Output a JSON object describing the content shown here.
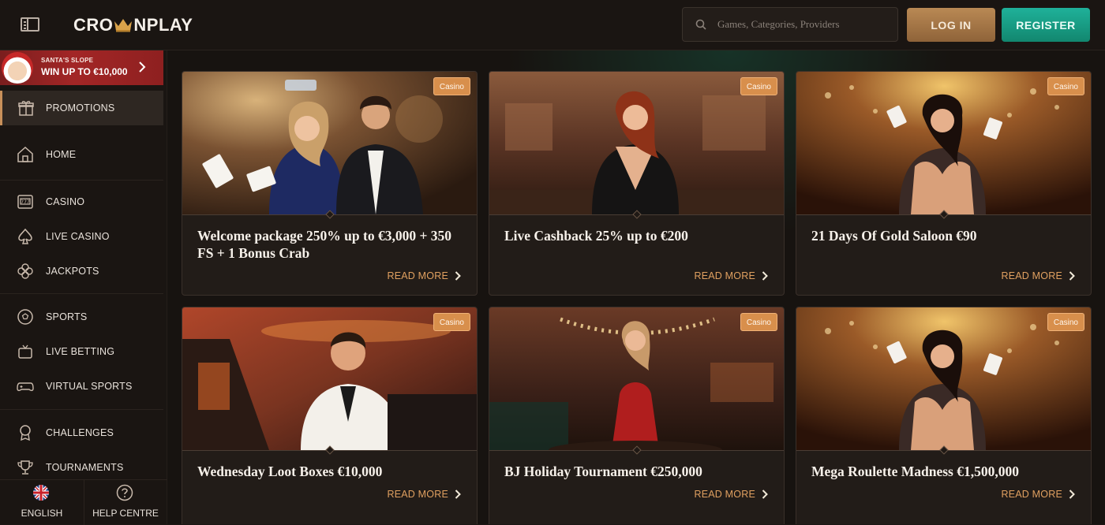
{
  "header": {
    "logo_left": "CRO",
    "logo_right": "NPLAY",
    "search_placeholder": "Games, Categories, Providers",
    "login_label": "LOG IN",
    "register_label": "REGISTER"
  },
  "sidebar": {
    "promo_banner": {
      "small": "SANTA'S SLOPE",
      "big": "WIN UP TO €10,000"
    },
    "active_item": {
      "label": "PROMOTIONS",
      "icon": "gift-icon"
    },
    "items": [
      {
        "label": "HOME",
        "icon": "home-icon"
      },
      {
        "label": "CASINO",
        "icon": "slot-machine-icon"
      },
      {
        "label": "LIVE CASINO",
        "icon": "spade-icon"
      },
      {
        "label": "JACKPOTS",
        "icon": "clover-icon"
      },
      {
        "label": "SPORTS",
        "icon": "soccer-ball-icon"
      },
      {
        "label": "LIVE BETTING",
        "icon": "tv-icon"
      },
      {
        "label": "VIRTUAL SPORTS",
        "icon": "gamepad-icon"
      },
      {
        "label": "CHALLENGES",
        "icon": "medal-icon"
      },
      {
        "label": "TOURNAMENTS",
        "icon": "trophy-icon"
      }
    ],
    "footer": {
      "language_label": "ENGLISH",
      "help_label": "HELP CENTRE"
    }
  },
  "promotions": [
    {
      "badge": "Casino",
      "title": "Welcome package 250% up to €3,000 + 350 FS + 1 Bonus Crab",
      "cta": "READ MORE"
    },
    {
      "badge": "Casino",
      "title": "Live Cashback 25% up to €200",
      "cta": "READ MORE"
    },
    {
      "badge": "Casino",
      "title": "21 Days Of Gold Saloon €90",
      "cta": "READ MORE"
    },
    {
      "badge": "Casino",
      "title": "Wednesday Loot Boxes €10,000",
      "cta": "READ MORE"
    },
    {
      "badge": "Casino",
      "title": "BJ Holiday Tournament €250,000",
      "cta": "READ MORE"
    },
    {
      "badge": "Casino",
      "title": "Mega Roulette Madness €1,500,000",
      "cta": "READ MORE"
    }
  ],
  "colors": {
    "accent_gold": "#e0a060",
    "badge_orange": "#d88f4c",
    "login_brown": "#a67545",
    "register_teal": "#1a9e86",
    "promo_red": "#a32626"
  }
}
